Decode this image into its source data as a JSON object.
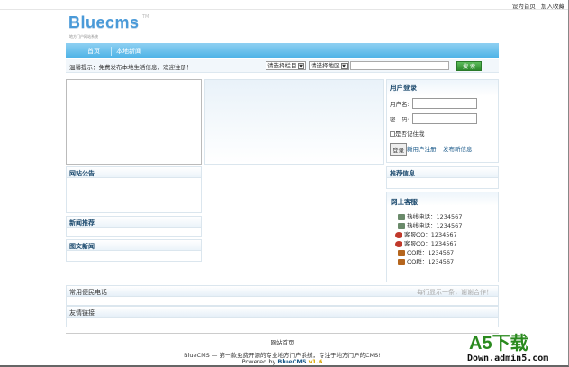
{
  "top_links": [
    "设为首页",
    "加入收藏"
  ],
  "logo": {
    "name": "Bluecms",
    "tm": "TM",
    "slogan": "地方门户网站系统"
  },
  "nav": [
    "首页",
    "本地新闻"
  ],
  "notice": "温馨提示：免费发布本地生活信息，欢迎注册！",
  "search": {
    "category": "请选择栏目",
    "area": "请选择地区",
    "keyword": "",
    "button": "搜 索"
  },
  "login": {
    "title": "用户登录",
    "username_label": "用户名:",
    "password_label": "密　码:",
    "remember": "是否记住我",
    "submit": "登录",
    "register": "新用户注册",
    "publish": "发布新信息"
  },
  "sections": {
    "announcement": "网站公告",
    "news_recommend": "新闻推荐",
    "photo_news": "图文新闻",
    "recommend_info": "推荐信息",
    "online_service": "网上客服",
    "phones": "常用便民电话",
    "phones_tip": "每行显示一条，谢谢合作！",
    "links": "友情链接"
  },
  "service": [
    {
      "icon": "phone-icon",
      "text": "热线电话：1234567"
    },
    {
      "icon": "phone-icon",
      "text": "热线电话：1234567"
    },
    {
      "icon": "qq-icon",
      "text": "客服QQ：1234567"
    },
    {
      "icon": "qq-icon",
      "text": "客服QQ：1234567"
    },
    {
      "icon": "group-icon",
      "text": "QQ群：1234567"
    },
    {
      "icon": "group-icon",
      "text": "QQ群：1234567"
    }
  ],
  "footer": {
    "home": "网站首页",
    "desc": "BlueCMS — 第一款免费开源的专业地方门户系统，专注于地方门户的CMS!",
    "powered": "Powered by",
    "brand": "BlueCMS",
    "version": "v1.6"
  },
  "watermark": {
    "main": "A5下载",
    "sub": "Down.admin5.com"
  }
}
